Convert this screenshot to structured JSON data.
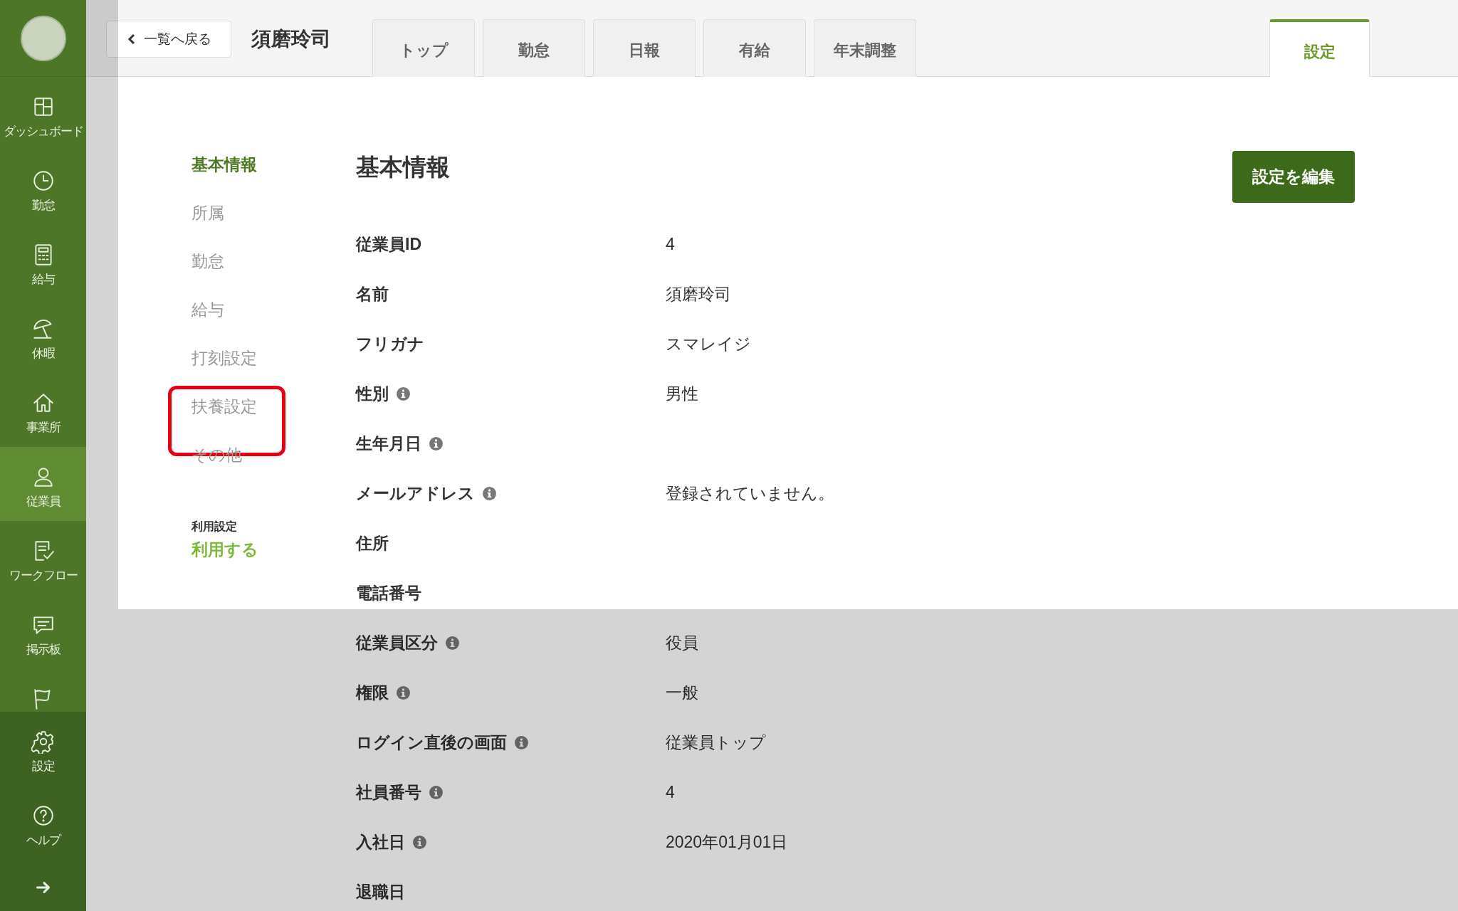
{
  "sidebar": {
    "items": [
      {
        "kind": "dashboard",
        "label": "ダッシュボード",
        "selected": false
      },
      {
        "kind": "clock",
        "label": "勤怠",
        "selected": false
      },
      {
        "kind": "calculator",
        "label": "給与",
        "selected": false
      },
      {
        "kind": "umbrella",
        "label": "休暇",
        "selected": false
      },
      {
        "kind": "house",
        "label": "事業所",
        "selected": false
      },
      {
        "kind": "person",
        "label": "従業員",
        "selected": true
      },
      {
        "kind": "checklist",
        "label": "ワークフロー",
        "selected": false
      },
      {
        "kind": "chat",
        "label": "掲示板",
        "selected": false
      },
      {
        "kind": "flag",
        "selected": false
      }
    ],
    "bottom_items": [
      {
        "kind": "gear",
        "label": "設定"
      },
      {
        "kind": "help",
        "label": "ヘルプ"
      },
      {
        "kind": "arrow"
      }
    ]
  },
  "header": {
    "back_button": "一覧へ戻る",
    "employee_name": "須磨玲司",
    "tabs": [
      {
        "label": "トップ",
        "selected": false
      },
      {
        "label": "勤怠",
        "selected": false
      },
      {
        "label": "日報",
        "selected": false
      },
      {
        "label": "有給",
        "selected": false
      },
      {
        "label": "年末調整",
        "selected": false
      }
    ],
    "settings_tab": {
      "label": "設定",
      "selected": true
    }
  },
  "sub_nav": {
    "items": [
      {
        "label": "基本情報",
        "selected": true,
        "highlighted": false
      },
      {
        "label": "所属",
        "selected": false,
        "highlighted": false
      },
      {
        "label": "勤怠",
        "selected": false,
        "highlighted": false
      },
      {
        "label": "給与",
        "selected": false,
        "highlighted": false
      },
      {
        "label": "打刻設定",
        "selected": false,
        "highlighted": false
      },
      {
        "label": "扶養設定",
        "selected": false,
        "highlighted": true
      },
      {
        "label": "その他",
        "selected": false,
        "highlighted": false
      }
    ],
    "usage": {
      "label": "利用設定",
      "value": "利用する"
    }
  },
  "details": {
    "title": "基本情報",
    "edit_button": "設定を編集",
    "rows": [
      {
        "label": "従業員ID",
        "info": false,
        "value": "4"
      },
      {
        "label": "名前",
        "info": false,
        "value": "須磨玲司"
      },
      {
        "label": "フリガナ",
        "info": false,
        "value": "スマレイジ"
      },
      {
        "label": "性別",
        "info": true,
        "value": "男性"
      },
      {
        "label": "生年月日",
        "info": true
      },
      {
        "label": "メールアドレス",
        "info": true,
        "value": "登録されていません。"
      },
      {
        "label": "住所",
        "info": false
      },
      {
        "label": "電話番号",
        "info": false
      },
      {
        "label": "従業員区分",
        "info": true,
        "value": "役員"
      },
      {
        "label": "権限",
        "info": true,
        "value": "一般"
      },
      {
        "label": "ログイン直後の画面",
        "info": true,
        "value": "従業員トップ"
      },
      {
        "label": "社員番号",
        "info": true,
        "value": "4"
      },
      {
        "label": "入社日",
        "info": true,
        "value": "2020年01月01日"
      },
      {
        "label": "退職日",
        "info": false
      }
    ]
  }
}
